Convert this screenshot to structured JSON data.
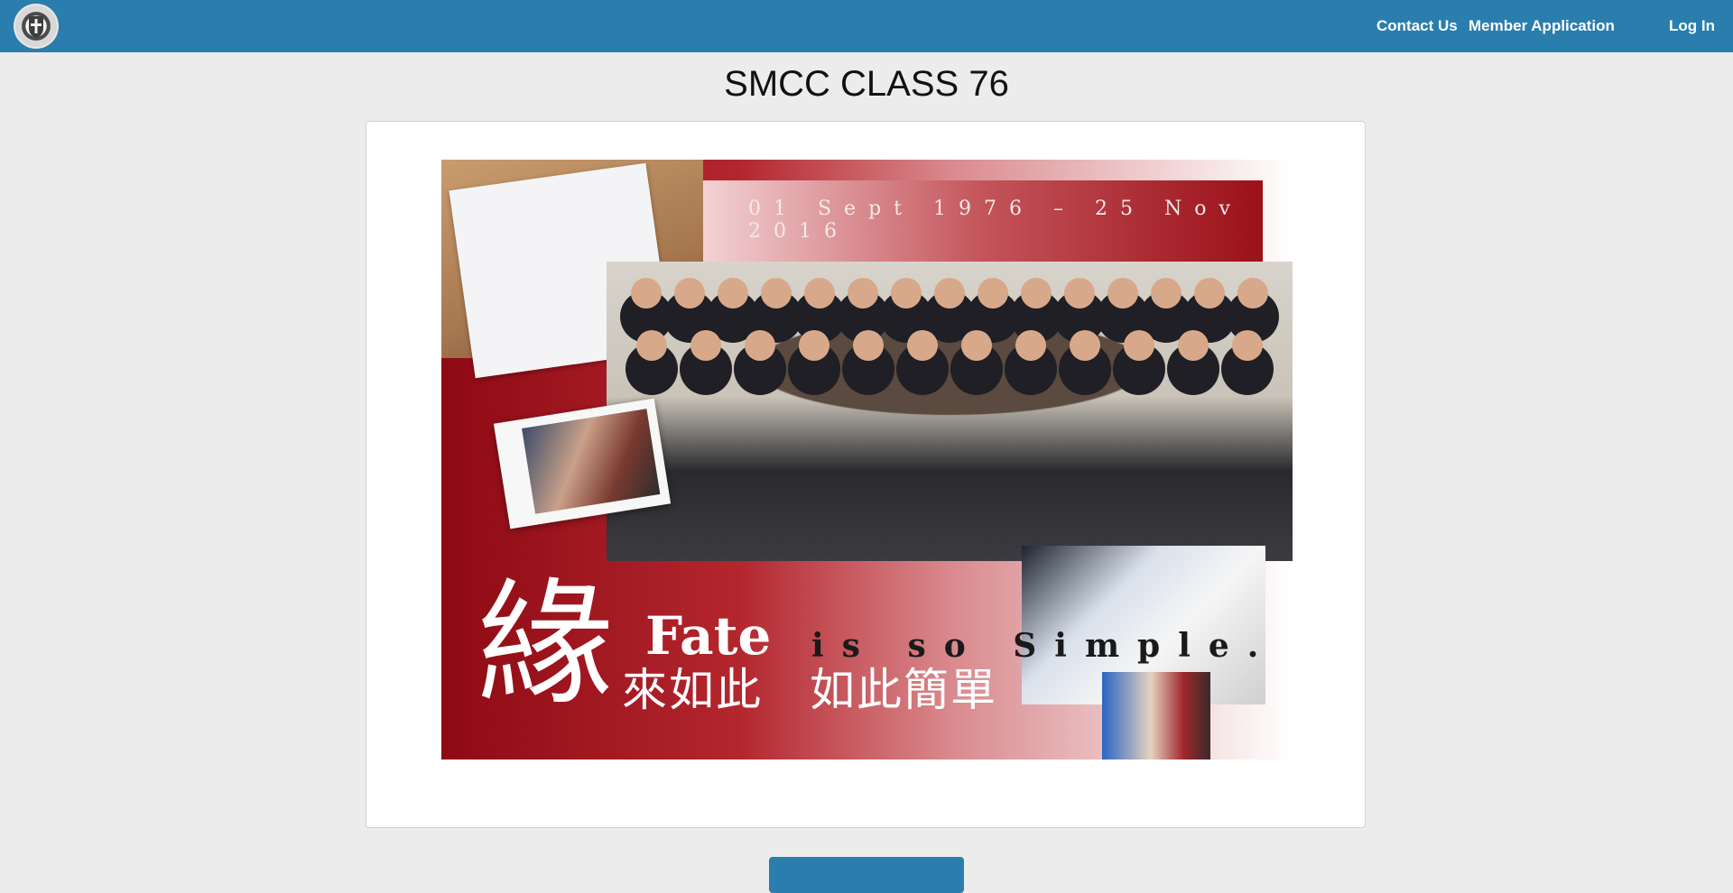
{
  "navbar": {
    "logo_icon": "school-crest-icon",
    "links": {
      "contact": "Contact Us",
      "member_application": "Member Application",
      "login": "Log In"
    },
    "background_color": "#2a7eae"
  },
  "page": {
    "title": "SMCC CLASS 76",
    "background_color": "#ececec"
  },
  "banner": {
    "dates": "01 Sept 1976 – 25 Nov 2016",
    "big_char": "緣",
    "fate": "Fate",
    "tagline": "is so Simple.",
    "chinese_line": "來如此　如此簡單"
  },
  "footer_button": {
    "label": ""
  }
}
